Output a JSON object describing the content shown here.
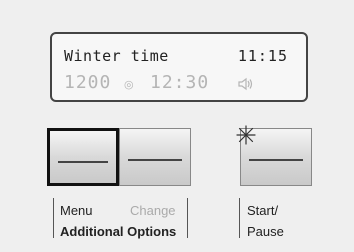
{
  "display": {
    "mode_text": "Winter time",
    "time": "11:15",
    "speed_value": "1200",
    "speed_unit": "◎",
    "duration": "12:30",
    "sound_icon": "speaker-icon"
  },
  "buttons": {
    "menu_label": "Menu",
    "change_label": "Change",
    "group_label": "Additional Options",
    "start_label": "Start/",
    "pause_label": "Pause"
  }
}
